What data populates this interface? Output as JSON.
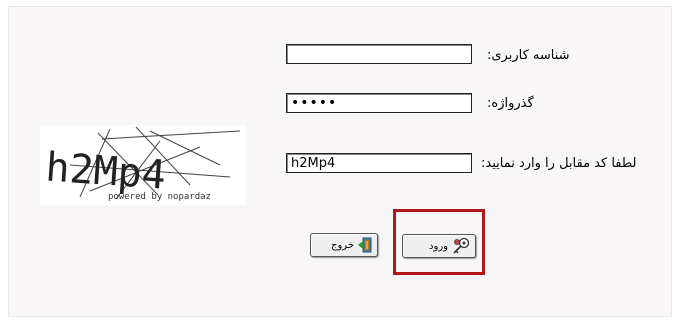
{
  "form": {
    "username_label": "شناسه کاربری:",
    "username_value": "",
    "password_label": "گذرواژه:",
    "password_value": "•••••",
    "captcha_label": "لطفا کد مقابل را وارد نمایید:",
    "captcha_value": "h2Mp4"
  },
  "captcha_image": {
    "text": "h2Mp4",
    "caption": "powered by nopardaz"
  },
  "buttons": {
    "enter_label": "ورود",
    "exit_label": "خروج"
  },
  "colors": {
    "highlight": "#b3151b",
    "background": "#f8f6f6"
  }
}
